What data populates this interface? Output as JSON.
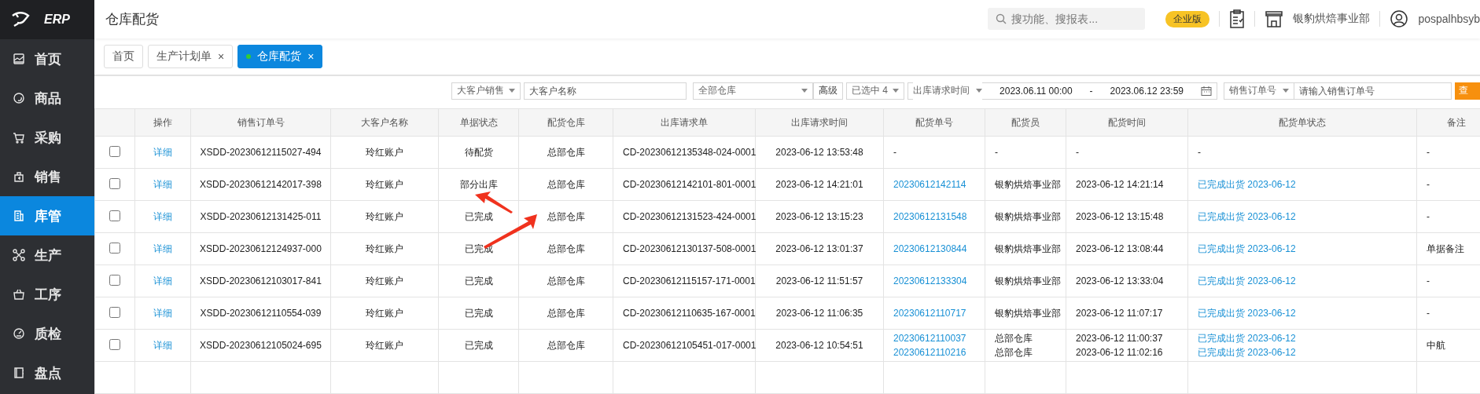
{
  "sidebar": {
    "logo": "ERP",
    "items": [
      {
        "label": "首页",
        "selected": false
      },
      {
        "label": "商品",
        "selected": false
      },
      {
        "label": "采购",
        "selected": false
      },
      {
        "label": "销售",
        "selected": false
      },
      {
        "label": "库管",
        "selected": true
      },
      {
        "label": "生产",
        "selected": false
      },
      {
        "label": "工序",
        "selected": false
      },
      {
        "label": "质检",
        "selected": false
      },
      {
        "label": "盘点",
        "selected": false
      }
    ]
  },
  "header": {
    "title": "仓库配货",
    "search": {
      "placeholder": "搜功能、搜报表..."
    },
    "edition_badge": "企业版",
    "store": "银豹烘焙事业部",
    "user": "pospalhbsyb"
  },
  "tabs": [
    {
      "label": "首页",
      "selected": false
    },
    {
      "label": "生产计划单",
      "close": "×",
      "selected": false
    },
    {
      "label": "仓库配货",
      "close": "×",
      "selected": true
    }
  ],
  "filters": {
    "customer_type": "大客户销售",
    "customer_name": {
      "placeholder": "大客户名称"
    },
    "warehouse": "全部仓库",
    "advanced": "高级",
    "selected_count": "已选中 4",
    "time_type": "出库请求时间",
    "date_from": "2023.06.11 00:00",
    "date_separator": "-",
    "date_to": "2023.06.12 23:59",
    "order_type": "销售订单号",
    "order_no": {
      "placeholder": "请输入销售订单号"
    },
    "query": "查"
  },
  "table": {
    "columns": [
      "操作",
      "销售订单号",
      "大客户名称",
      "单据状态",
      "配货仓库",
      "出库请求单",
      "出库请求时间",
      "配货单号",
      "配货员",
      "配货时间",
      "配货单状态",
      "备注"
    ],
    "rows": [
      {
        "checked": false,
        "action": "详细",
        "sales_order_no": "XSDD-20230612115027-494",
        "customer": "玲红账户",
        "status": "待配货",
        "warehouse": "总部仓库",
        "outbound_request": "CD-20230612135348-024-0001",
        "request_time": "2023-06-12 13:53:48",
        "picking": [
          {
            "no": "-",
            "picker": "-",
            "time": "-",
            "status": "-",
            "linked": false
          }
        ],
        "remark": "-"
      },
      {
        "checked": false,
        "action": "详细",
        "sales_order_no": "XSDD-20230612142017-398",
        "customer": "玲红账户",
        "status": "部分出库",
        "warehouse": "总部仓库",
        "outbound_request": "CD-20230612142101-801-0001",
        "request_time": "2023-06-12 14:21:01",
        "picking": [
          {
            "no": "20230612142114",
            "picker": "银豹烘焙事业部",
            "time": "2023-06-12 14:21:14",
            "status": "已完成出货 2023-06-12",
            "linked": true
          }
        ],
        "remark": "-"
      },
      {
        "checked": false,
        "action": "详细",
        "sales_order_no": "XSDD-20230612131425-011",
        "customer": "玲红账户",
        "status": "已完成",
        "warehouse": "总部仓库",
        "outbound_request": "CD-20230612131523-424-0001",
        "request_time": "2023-06-12 13:15:23",
        "picking": [
          {
            "no": "20230612131548",
            "picker": "银豹烘焙事业部",
            "time": "2023-06-12 13:15:48",
            "status": "已完成出货 2023-06-12",
            "linked": true
          }
        ],
        "remark": "-"
      },
      {
        "checked": false,
        "action": "详细",
        "sales_order_no": "XSDD-20230612124937-000",
        "customer": "玲红账户",
        "status": "已完成",
        "warehouse": "总部仓库",
        "outbound_request": "CD-20230612130137-508-0001",
        "request_time": "2023-06-12 13:01:37",
        "picking": [
          {
            "no": "20230612130844",
            "picker": "银豹烘焙事业部",
            "time": "2023-06-12 13:08:44",
            "status": "已完成出货 2023-06-12",
            "linked": true
          }
        ],
        "remark": "单据备注"
      },
      {
        "checked": false,
        "action": "详细",
        "sales_order_no": "XSDD-20230612103017-841",
        "customer": "玲红账户",
        "status": "已完成",
        "warehouse": "总部仓库",
        "outbound_request": "CD-20230612115157-171-0001",
        "request_time": "2023-06-12 11:51:57",
        "picking": [
          {
            "no": "20230612133304",
            "picker": "银豹烘焙事业部",
            "time": "2023-06-12 13:33:04",
            "status": "已完成出货 2023-06-12",
            "linked": true
          }
        ],
        "remark": "-"
      },
      {
        "checked": false,
        "action": "详细",
        "sales_order_no": "XSDD-20230612110554-039",
        "customer": "玲红账户",
        "status": "已完成",
        "warehouse": "总部仓库",
        "outbound_request": "CD-20230612110635-167-0001",
        "request_time": "2023-06-12 11:06:35",
        "picking": [
          {
            "no": "20230612110717",
            "picker": "银豹烘焙事业部",
            "time": "2023-06-12 11:07:17",
            "status": "已完成出货 2023-06-12",
            "linked": true
          }
        ],
        "remark": "-"
      },
      {
        "checked": false,
        "action": "详细",
        "sales_order_no": "XSDD-20230612105024-695",
        "customer": "玲红账户",
        "status": "已完成",
        "warehouse": "总部仓库",
        "outbound_request": "CD-20230612105451-017-0001",
        "request_time": "2023-06-12 10:54:51",
        "picking": [
          {
            "no": "20230612110037",
            "picker": "总部仓库",
            "time": "2023-06-12 11:00:37",
            "status": "已完成出货 2023-06-12",
            "linked": true
          },
          {
            "no": "20230612110216",
            "picker": "总部仓库",
            "time": "2023-06-12 11:02:16",
            "status": "已完成出货 2023-06-12",
            "linked": true
          }
        ],
        "remark": "中航"
      }
    ]
  }
}
